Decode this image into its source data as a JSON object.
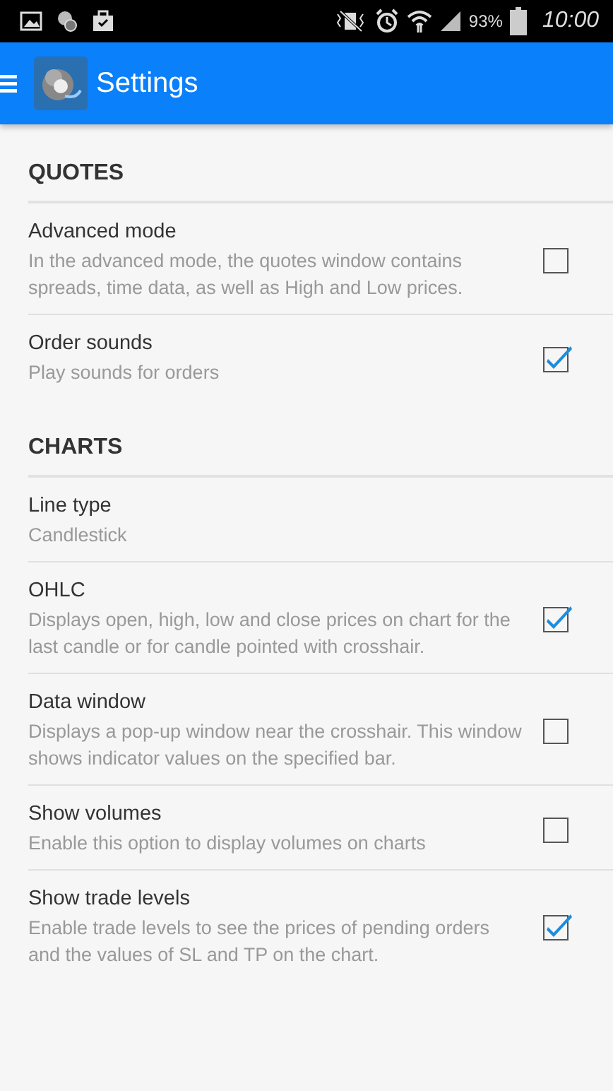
{
  "status_bar": {
    "battery": "93%",
    "time": "10:00"
  },
  "app_bar": {
    "title": "Settings"
  },
  "sections": [
    {
      "title": "QUOTES",
      "items": [
        {
          "kind": "checkbox",
          "title": "Advanced mode",
          "summary": "In the advanced mode, the quotes window contains spreads, time data, as well as High and Low prices.",
          "checked": false
        },
        {
          "kind": "checkbox",
          "title": "Order sounds",
          "summary": "Play sounds for orders",
          "checked": true
        }
      ]
    },
    {
      "title": "CHARTS",
      "items": [
        {
          "kind": "value",
          "title": "Line type",
          "summary": "Candlestick"
        },
        {
          "kind": "checkbox",
          "title": "OHLC",
          "summary": "Displays open, high, low and close prices on chart for the last candle or for candle pointed with crosshair.",
          "checked": true
        },
        {
          "kind": "checkbox",
          "title": "Data window",
          "summary": "Displays a pop-up window near the crosshair. This window shows indicator values on the specified bar.",
          "checked": false
        },
        {
          "kind": "checkbox",
          "title": "Show volumes",
          "summary": "Enable this option to display volumes on charts",
          "checked": false
        },
        {
          "kind": "checkbox",
          "title": "Show trade levels",
          "summary": "Enable trade levels to see the prices of pending orders and the values of SL and TP on the chart.",
          "checked": true
        }
      ]
    }
  ]
}
